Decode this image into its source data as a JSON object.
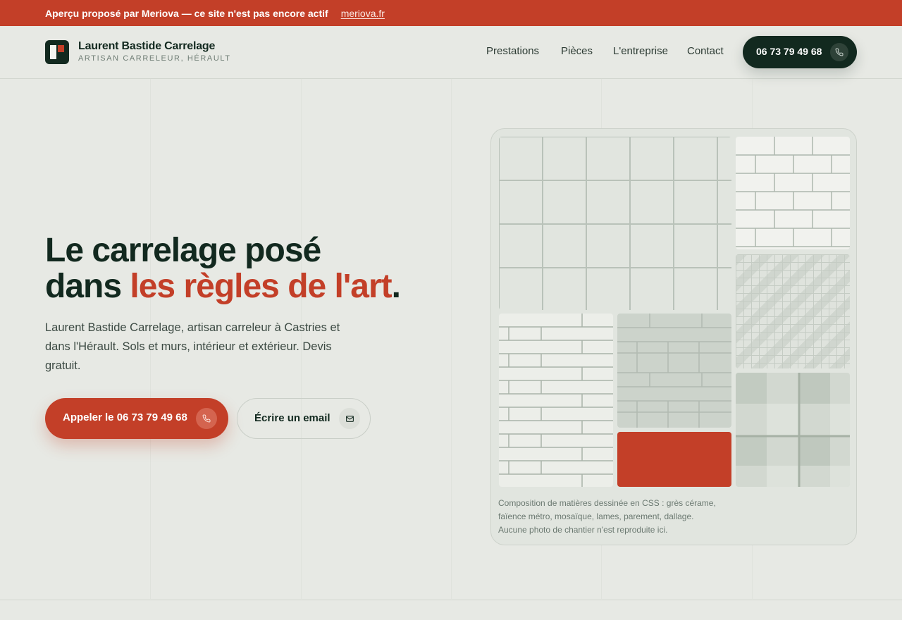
{
  "promo": {
    "text": "Aperçu proposé par Meriova — ce site n'est pas encore actif",
    "link": "meriova.fr"
  },
  "brand": {
    "name": "Laurent Bastide Carrelage",
    "tagline": "ARTISAN CARRELEUR, HÉRAULT"
  },
  "nav": {
    "items": [
      "Prestations",
      "Pièces",
      "L'entreprise",
      "Contact"
    ],
    "phone_label": "06 73 79 49 68"
  },
  "hero": {
    "title_line1": "Le carrelage posé",
    "title_line2_pre": "dans ",
    "title_line2_accent": "les règles de l'art",
    "title_line2_post": ".",
    "lead": "Laurent Bastide Carrelage, artisan carreleur à Castries et dans l'Hérault. Sols et murs, intérieur et extérieur. Devis gratuit.",
    "cta_call": "Appeler le 06 73 79 49 68",
    "cta_email": "Écrire un email"
  },
  "composition": {
    "caption_line1": "Composition de matières dessinée en CSS : grès cérame,",
    "caption_line2": "faïence métro, mosaïque, lames, parement, dallage.",
    "caption_line3": "Aucune photo de chantier n'est reproduite ici."
  },
  "colors": {
    "accent": "#c33f28",
    "dark": "#12291f",
    "background": "#e7e9e4"
  },
  "icons": {
    "phone": "phone-icon",
    "email": "mail-icon"
  }
}
